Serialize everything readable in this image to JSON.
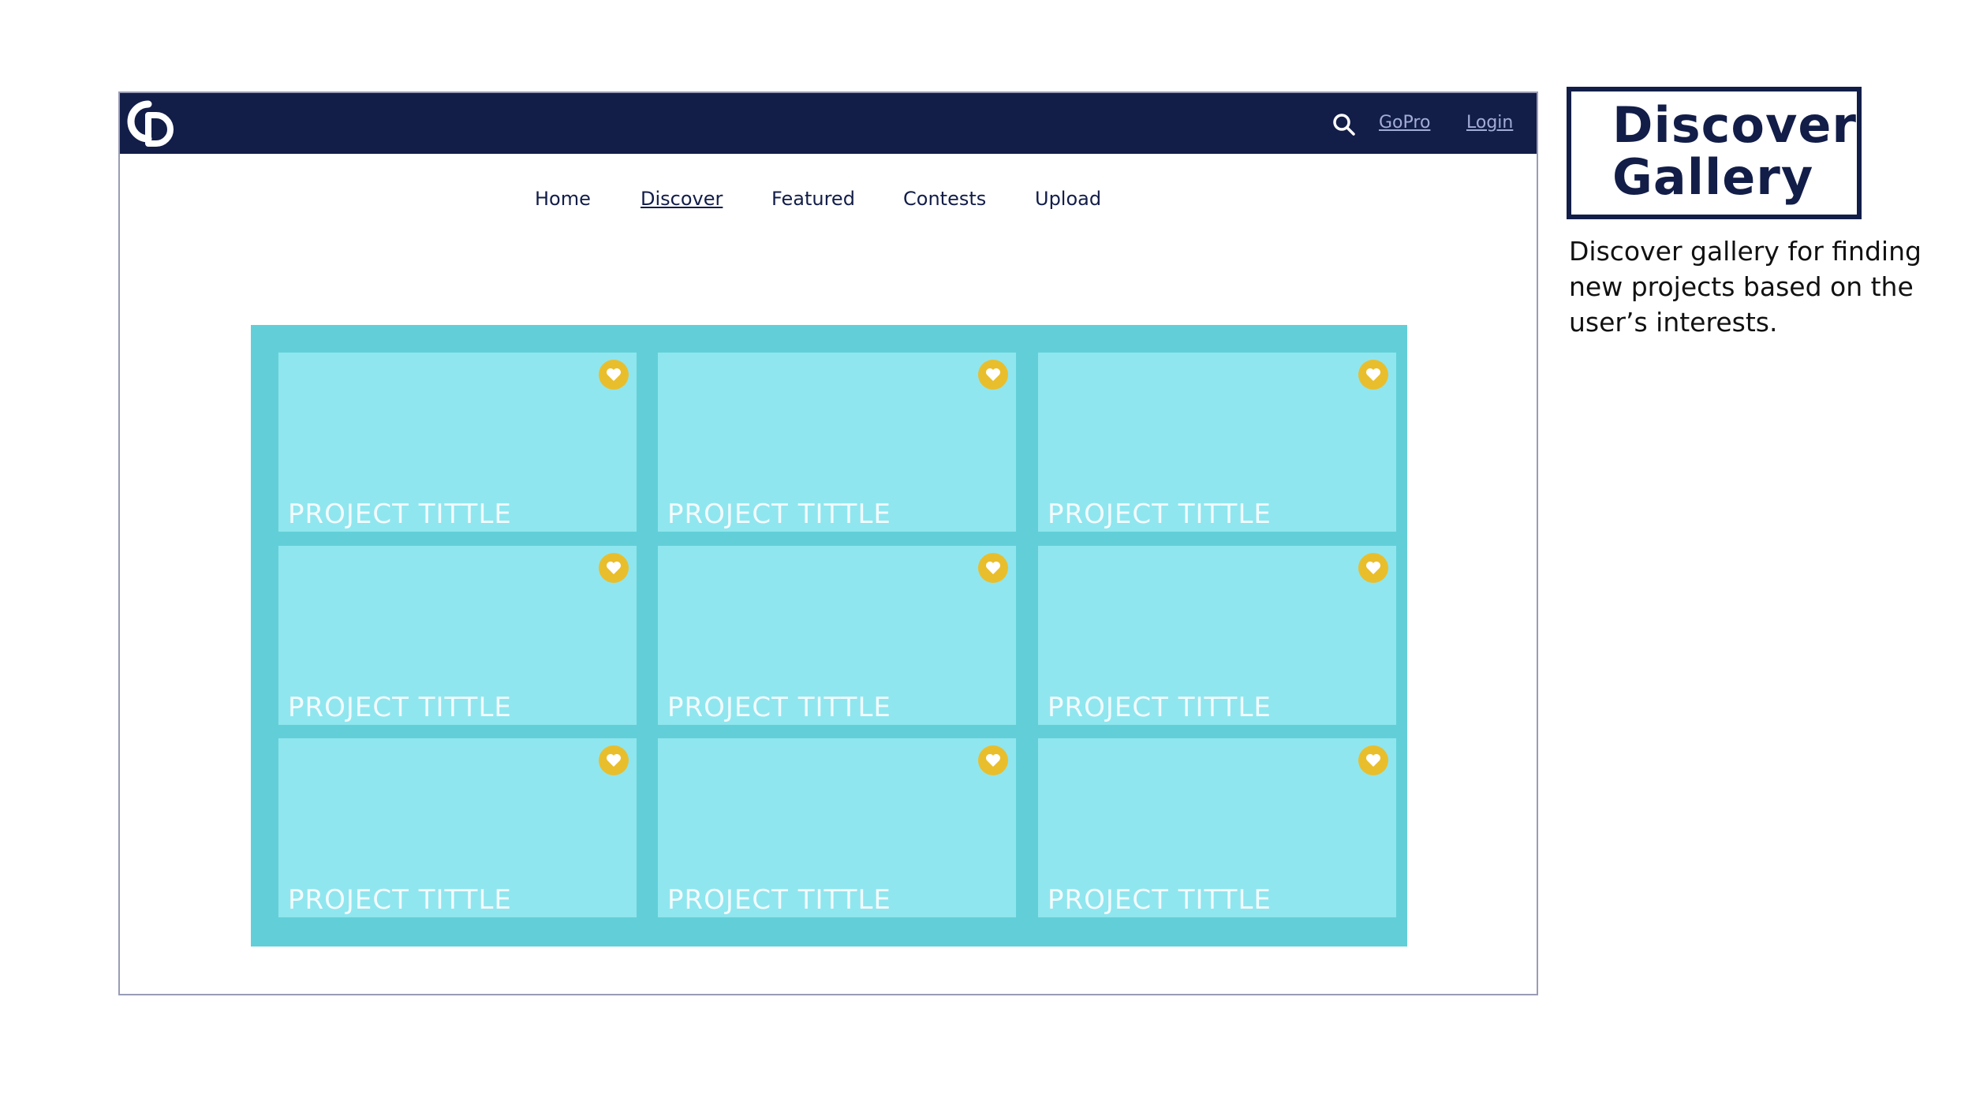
{
  "header": {
    "logo_icon": "cd-logo-icon",
    "search_icon": "search-icon",
    "gopro_label": "GoPro",
    "login_label": "Login"
  },
  "nav": {
    "items": [
      {
        "label": "Home",
        "active": false
      },
      {
        "label": "Discover",
        "active": true
      },
      {
        "label": "Featured",
        "active": false
      },
      {
        "label": "Contests",
        "active": false
      },
      {
        "label": "Upload",
        "active": false
      }
    ]
  },
  "gallery": {
    "cards": [
      {
        "title": "PROJECT TITTLE",
        "favorite_icon": "heart-icon"
      },
      {
        "title": "PROJECT TITTLE",
        "favorite_icon": "heart-icon"
      },
      {
        "title": "PROJECT TITTLE",
        "favorite_icon": "heart-icon"
      },
      {
        "title": "PROJECT TITTLE",
        "favorite_icon": "heart-icon"
      },
      {
        "title": "PROJECT TITTLE",
        "favorite_icon": "heart-icon"
      },
      {
        "title": "PROJECT TITTLE",
        "favorite_icon": "heart-icon"
      },
      {
        "title": "PROJECT TITTLE",
        "favorite_icon": "heart-icon"
      },
      {
        "title": "PROJECT TITTLE",
        "favorite_icon": "heart-icon"
      },
      {
        "title": "PROJECT TITTLE",
        "favorite_icon": "heart-icon"
      }
    ]
  },
  "annotation": {
    "label_line1": "Discover",
    "label_line2": "Gallery",
    "description": "Discover gallery for finding new projects based on the user’s interests."
  },
  "colors": {
    "navy": "#121d48",
    "gallery_bg": "#62cfd8",
    "card_bg": "#90e6ee",
    "favorite": "#e9be2c"
  }
}
